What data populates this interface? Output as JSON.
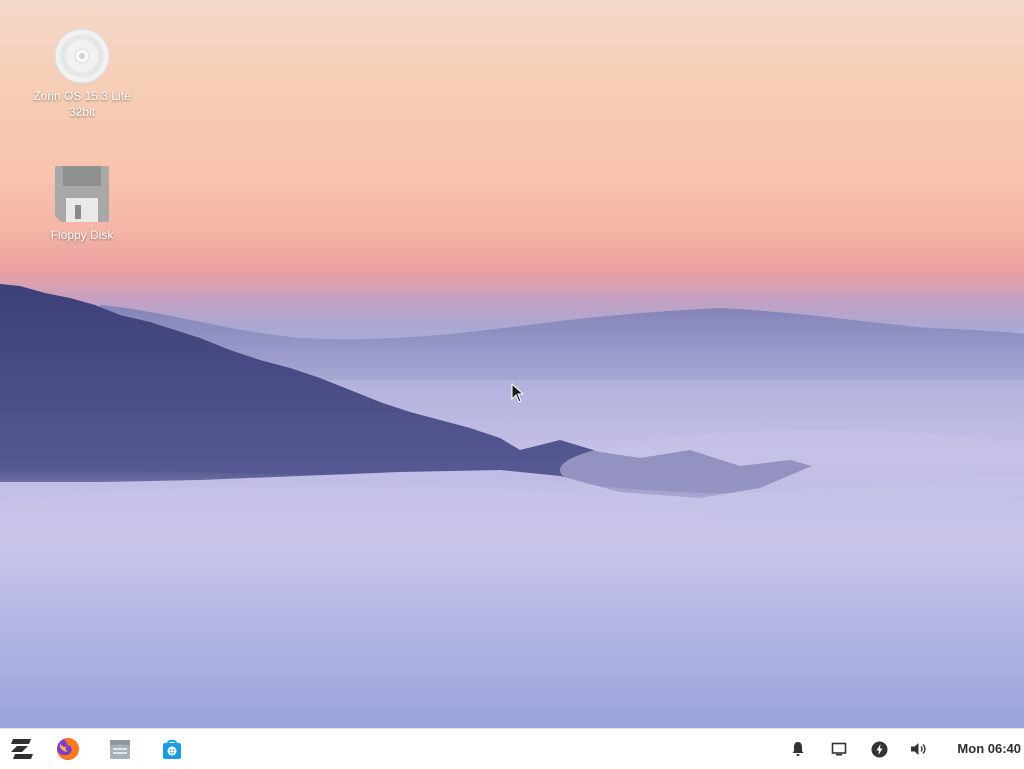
{
  "desktop": {
    "icons": [
      {
        "label_line1": "Zorin OS 15.3 Lite",
        "label_line2": "32bit",
        "icon": "disc-icon"
      },
      {
        "label": "Floppy Disk",
        "icon": "floppy-disk-icon"
      }
    ]
  },
  "taskbar": {
    "launchers": [
      {
        "icon": "zorin-menu-icon"
      },
      {
        "icon": "firefox-icon"
      },
      {
        "icon": "files-icon"
      },
      {
        "icon": "software-store-icon"
      }
    ],
    "tray": [
      {
        "icon": "notification-bell-icon"
      },
      {
        "icon": "display-icon"
      },
      {
        "icon": "power-icon"
      },
      {
        "icon": "volume-icon"
      }
    ],
    "clock": "Mon 06:40"
  }
}
